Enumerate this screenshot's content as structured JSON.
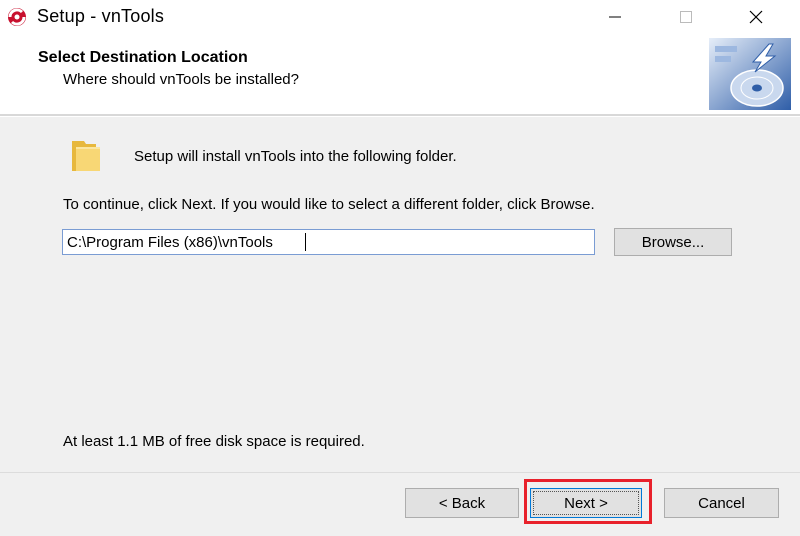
{
  "window": {
    "title": "Setup - vnTools"
  },
  "header": {
    "title": "Select Destination Location",
    "subtitle": "Where should vnTools be installed?"
  },
  "content": {
    "intro": "Setup will install vnTools into the following folder.",
    "continue_hint": "To continue, click Next. If you would like to select a different folder, click Browse.",
    "install_path": "C:\\Program Files (x86)\\vnTools",
    "browse_label": "Browse...",
    "disk_space": "At least 1.1 MB of free disk space is required."
  },
  "footer": {
    "back_label": "< Back",
    "next_label": "Next >",
    "cancel_label": "Cancel"
  },
  "colors": {
    "highlight": "#e8212b",
    "input_border": "#7a9cd3",
    "button_face": "#e1e1e1",
    "panel": "#f0f0f0"
  }
}
